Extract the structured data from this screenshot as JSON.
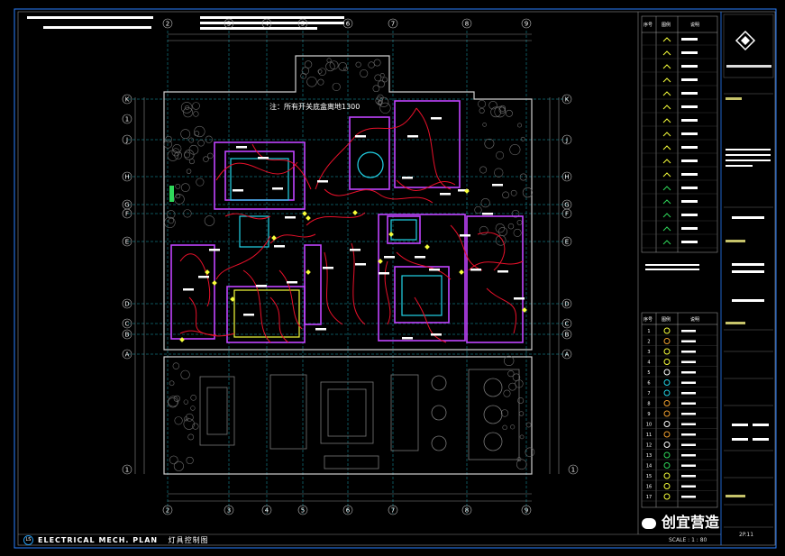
{
  "drawing": {
    "note_text": "注：所有开关底盒离地1300",
    "footer_title_en": "ELECTRICAL MECH. PLAN",
    "footer_title_cn": "灯具控制图",
    "footer_badge": "LS",
    "scale_text": "SCALE : 1 : 80",
    "sheet_no": "2P.11",
    "watermark_text": "创宜营造"
  },
  "grid": {
    "columns": [
      "2",
      "3",
      "4",
      "5",
      "6",
      "7",
      "8",
      "9"
    ],
    "rows": [
      "K",
      "J",
      "H",
      "G",
      "F",
      "E",
      "D",
      "C",
      "B",
      "A"
    ],
    "top_extra": "1",
    "bottom_extra": "1"
  },
  "legend": {
    "header": [
      "序号",
      "图例",
      "说明"
    ],
    "rows_bottom": [
      "1",
      "2",
      "3",
      "4",
      "5",
      "6",
      "7",
      "8",
      "9",
      "10",
      "11",
      "12",
      "13",
      "14",
      "15",
      "16",
      "17"
    ]
  },
  "colors": {
    "wire": "#e8102a",
    "wall_magenta": "#c043ff",
    "cyan": "#22d4e8",
    "yellow": "#f7ff3a",
    "green": "#2fd85a",
    "white": "#ffffff",
    "gray": "#8a8a8a",
    "blue": "#2a7fff"
  }
}
